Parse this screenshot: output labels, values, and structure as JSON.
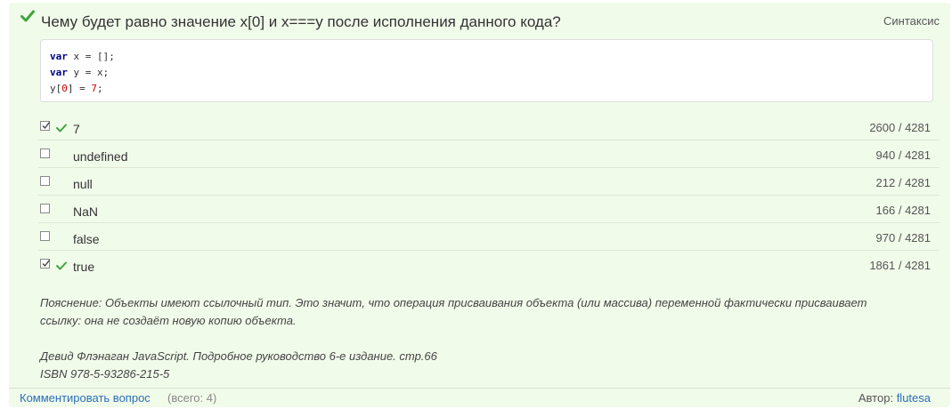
{
  "question": {
    "title": "Чему будет равно значение x[0] и x===y после исполнения данного кода?",
    "topic": "Синтаксис",
    "status_icon": "check-icon",
    "accent_color": "#3fa43f"
  },
  "code": {
    "line1_kw": "var",
    "line1_rest": " x = [];",
    "line2_kw": "var",
    "line2_rest": " y = x;",
    "line3_a": "y[",
    "line3_idx": "0",
    "line3_b": "] = ",
    "line3_val": "7",
    "line3_end": ";"
  },
  "answers": [
    {
      "text": "7",
      "count": "2600 / 4281",
      "checked": true,
      "correct": true
    },
    {
      "text": "undefined",
      "count": "940 / 4281",
      "checked": false,
      "correct": false
    },
    {
      "text": "null",
      "count": "212 / 4281",
      "checked": false,
      "correct": false
    },
    {
      "text": "NaN",
      "count": "166 / 4281",
      "checked": false,
      "correct": false
    },
    {
      "text": "false",
      "count": "970 / 4281",
      "checked": false,
      "correct": false
    },
    {
      "text": "true",
      "count": "1861 / 4281",
      "checked": true,
      "correct": true
    }
  ],
  "explanation": {
    "line1": "Пояснение: Объекты имеют ссылочный тип. Это значит, что операция присваивания объекта (или массива) переменной фактически присваивает",
    "line2": "ссылку: она не создаёт новую копию объекта."
  },
  "source": {
    "line1": "Девид Флэнаган JavaScript. Подробное руководство 6-е издание. стр.66",
    "line2": "ISBN 978-5-93286-215-5"
  },
  "footer": {
    "comment_link": "Комментировать вопрос",
    "comment_count": "(всего: 4)",
    "author_label": "Автор: ",
    "author_name": "flutesa"
  }
}
